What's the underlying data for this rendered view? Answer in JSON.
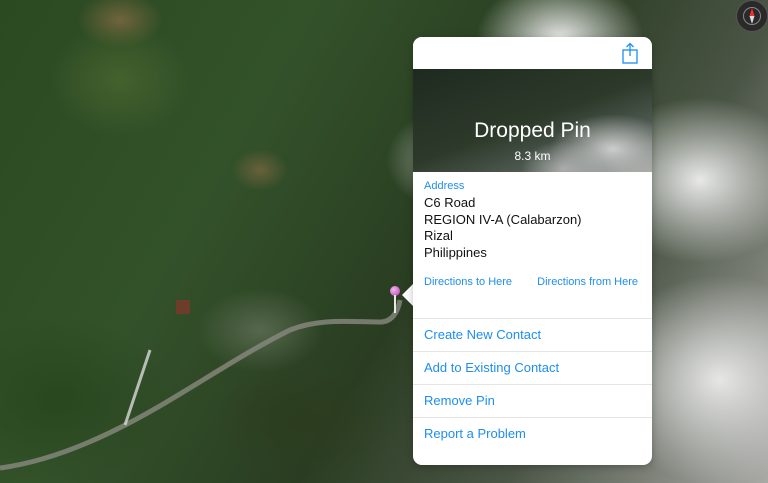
{
  "map": {
    "type": "satellite"
  },
  "compass": {
    "icon": "compass-icon"
  },
  "pin": {
    "icon": "dropped-pin-icon",
    "color": "#b23bb0"
  },
  "popover": {
    "share_icon": "share-icon",
    "title": "Dropped Pin",
    "distance": "8.3 km",
    "address": {
      "label": "Address",
      "lines": [
        "C6 Road",
        "REGION IV-A (Calabarzon)",
        "Rizal",
        "Philippines"
      ]
    },
    "directions_to": "Directions to Here",
    "directions_from": "Directions from Here",
    "actions": [
      "Create New Contact",
      "Add to Existing Contact",
      "Remove Pin",
      "Report a Problem"
    ],
    "accent_color": "#1d8ef0"
  }
}
